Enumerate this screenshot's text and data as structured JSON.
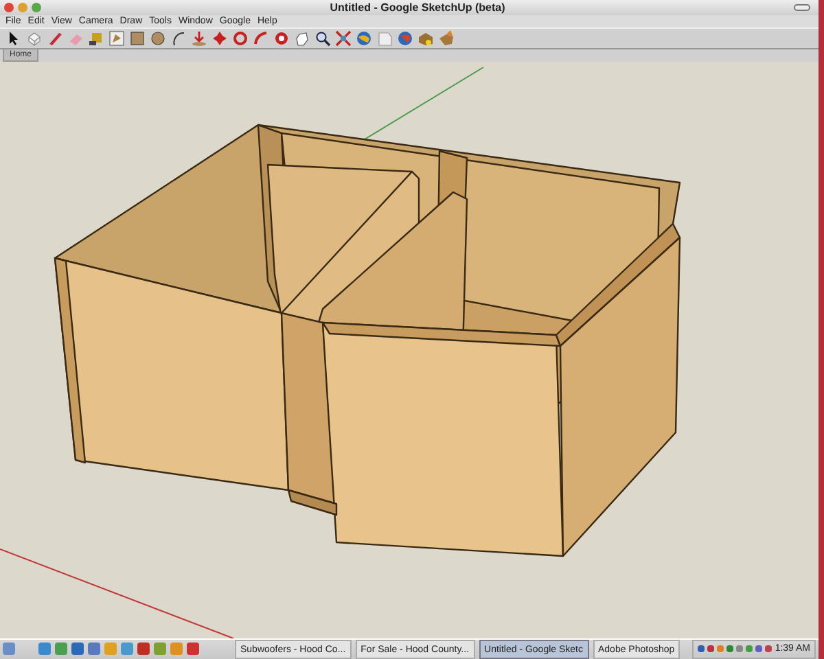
{
  "window": {
    "title": "Untitled - Google SketchUp (beta)"
  },
  "menu": [
    "File",
    "Edit",
    "View",
    "Camera",
    "Draw",
    "Tools",
    "Window",
    "Google",
    "Help"
  ],
  "scene_tabs": [
    {
      "label": "Home",
      "selected": true
    }
  ],
  "taskbar": {
    "buttons": [
      {
        "label": "Subwoofers - Hood Co...",
        "selected": false
      },
      {
        "label": "For Sale - Hood County...",
        "selected": false
      },
      {
        "label": "Untitled - Google Sketc",
        "selected": true
      },
      {
        "label": "Adobe Photoshop",
        "selected": false
      }
    ],
    "clock": "1:39 AM"
  }
}
